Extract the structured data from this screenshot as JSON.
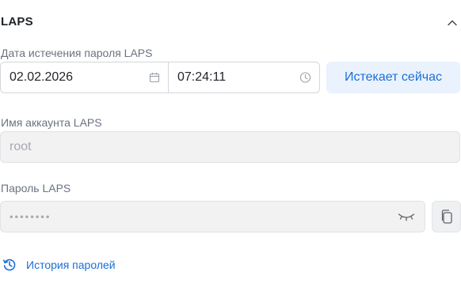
{
  "section": {
    "title": "LAPS",
    "collapse_icon": "chevron-up-icon"
  },
  "expiry": {
    "label": "Дата истечения пароля LAPS",
    "date_value": "02.02.2026",
    "time_value": "07:24:11",
    "expire_now_label": "Истекает сейчас"
  },
  "account": {
    "label": "Имя аккаунта LAPS",
    "value": "root"
  },
  "password": {
    "label": "Пароль LAPS",
    "masked_value": "••••••••",
    "toggle_icon": "eye-closed-icon",
    "copy_icon": "copy-icon"
  },
  "history": {
    "label": "История паролей",
    "icon": "history-icon"
  },
  "colors": {
    "accent": "#1a6fd6",
    "accent_bg": "#eaf2fd",
    "muted_text": "#6b7280",
    "disabled_bg": "#f2f2f3"
  }
}
